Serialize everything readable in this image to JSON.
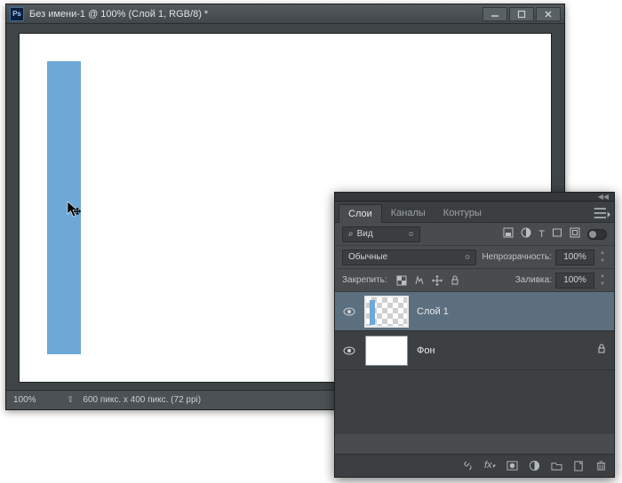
{
  "window": {
    "app_abbr": "Ps",
    "title": "Без имени-1 @ 100% (Слой 1, RGB/8) *"
  },
  "canvas": {
    "shape_color": "#6da8d6"
  },
  "statusbar": {
    "zoom": "100%",
    "doc_info": "600 пикс. x 400 пикс. (72 ppi)"
  },
  "panel": {
    "tabs": {
      "layers": "Слои",
      "channels": "Каналы",
      "paths": "Контуры"
    },
    "kind_label": "Вид",
    "blend_mode": "Обычные",
    "opacity_label": "Непрозрачность:",
    "opacity_value": "100%",
    "lock_label": "Закрепить:",
    "fill_label": "Заливка:",
    "fill_value": "100%",
    "layers": [
      {
        "name": "Слой 1",
        "visible": true,
        "selected": true,
        "locked": false,
        "thumb": "checker"
      },
      {
        "name": "Фон",
        "visible": true,
        "selected": false,
        "locked": true,
        "thumb": "white"
      }
    ],
    "footer_icons": [
      "link-icon",
      "fx-icon",
      "mask-icon",
      "adjustment-icon",
      "group-icon",
      "new-layer-icon",
      "trash-icon"
    ]
  }
}
